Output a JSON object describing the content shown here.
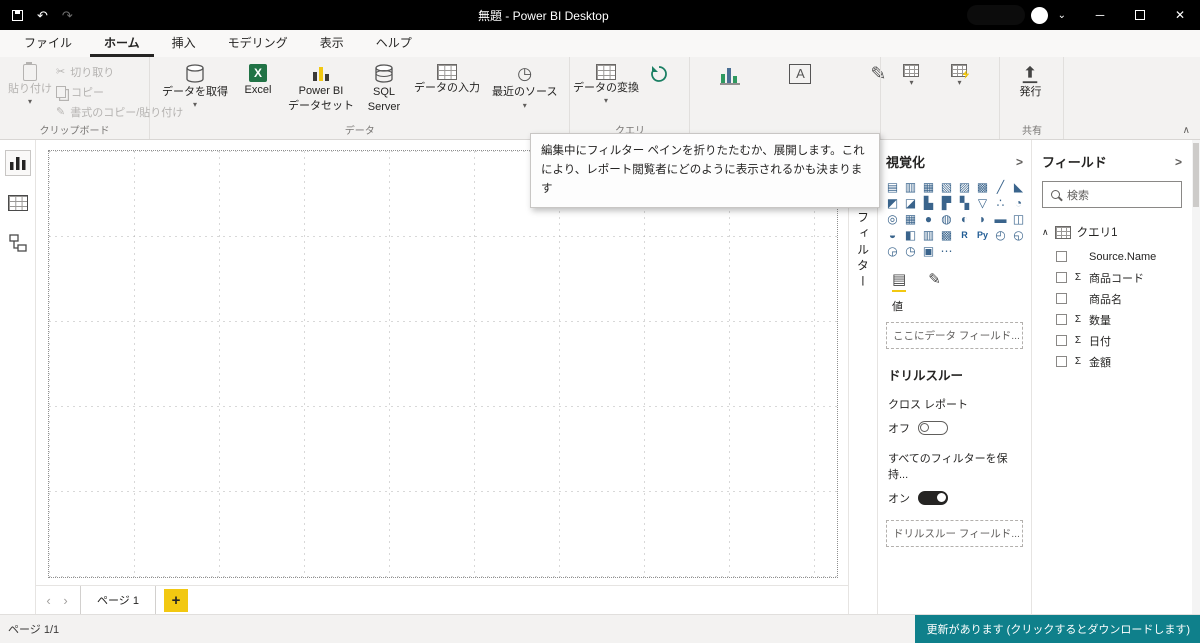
{
  "colors": {
    "accent_yellow": "#F2C811",
    "status_teal": "#0F808B",
    "titlebar_black": "#000000"
  },
  "titlebar": {
    "title": "無題 - Power BI Desktop"
  },
  "icons": {
    "undo": "↶",
    "redo": "↷",
    "chevron_down": "▾",
    "chevron_up": "∧",
    "collapse_left": "<",
    "collapse_right": ">",
    "minimize": "─",
    "close": "✕",
    "scissors": "✂",
    "pencil": "✎",
    "clock": "◷",
    "letter_a": "A",
    "prev": "‹",
    "next": "›",
    "add": "+",
    "account_chev": "⌄",
    "sigma": "Σ"
  },
  "menu": {
    "items": [
      "ファイル",
      "ホーム",
      "挿入",
      "モデリング",
      "表示",
      "ヘルプ"
    ],
    "active_index": 1
  },
  "ribbon": {
    "clipboard": {
      "group": "クリップボード",
      "paste": "貼り付け",
      "cut": "切り取り",
      "copy": "コピー",
      "format": "書式のコピー/貼り付け"
    },
    "data": {
      "group": "データ",
      "get_data": "データを取得",
      "excel": "Excel",
      "pbi1": "Power BI",
      "pbi2": "データセット",
      "sql1": "SQL",
      "sql2": "Server",
      "enter": "データの入力",
      "recent": "最近のソース"
    },
    "queries": {
      "group": "クエリ",
      "transform": "データの変換"
    },
    "share": {
      "group": "共有",
      "publish": "発行"
    },
    "tooltip": "編集中にフィルター ペインを折りたたむか、展開します。これにより、レポート閲覧者にどのように表示されるかも決まります"
  },
  "filters": {
    "title": "フィルター"
  },
  "visualizations": {
    "title": "視覚化",
    "values_label": "値",
    "field_placeholder": "ここにデータ フィールド...",
    "drillthrough": {
      "title": "ドリルスルー",
      "cross_report": "クロス レポート",
      "off": "オフ",
      "keep_filters": "すべてのフィルターを保持...",
      "on": "オン",
      "field_placeholder": "ドリルスルー フィールド..."
    },
    "icons": [
      {
        "name": "stacked-bar-chart",
        "glyph": "▤"
      },
      {
        "name": "stacked-column-chart",
        "glyph": "▥"
      },
      {
        "name": "clustered-bar-chart",
        "glyph": "▦"
      },
      {
        "name": "clustered-column-chart",
        "glyph": "▧"
      },
      {
        "name": "100-stacked-bar-chart",
        "glyph": "▨"
      },
      {
        "name": "100-stacked-column-chart",
        "glyph": "▩"
      },
      {
        "name": "line-chart",
        "glyph": "╱"
      },
      {
        "name": "area-chart",
        "glyph": "◣"
      },
      {
        "name": "stacked-area-chart",
        "glyph": "◩"
      },
      {
        "name": "line-and-stacked-column-chart",
        "glyph": "◪"
      },
      {
        "name": "line-and-clustered-column-chart",
        "glyph": "▙"
      },
      {
        "name": "ribbon-chart",
        "glyph": "▛"
      },
      {
        "name": "waterfall-chart",
        "glyph": "▚"
      },
      {
        "name": "funnel-chart",
        "glyph": "▽"
      },
      {
        "name": "scatter-chart",
        "glyph": "∴"
      },
      {
        "name": "pie-chart",
        "glyph": "◔"
      },
      {
        "name": "donut-chart",
        "glyph": "◎"
      },
      {
        "name": "treemap-chart",
        "glyph": "▦"
      },
      {
        "name": "map",
        "glyph": "●"
      },
      {
        "name": "filled-map",
        "glyph": "◍"
      },
      {
        "name": "shape-map",
        "glyph": "◐"
      },
      {
        "name": "gauge-chart",
        "glyph": "◗"
      },
      {
        "name": "card-visual",
        "glyph": "▬"
      },
      {
        "name": "multi-row-card",
        "glyph": "◫"
      },
      {
        "name": "kpi-visual",
        "glyph": "◒"
      },
      {
        "name": "slicer",
        "glyph": "◧"
      },
      {
        "name": "table-visual",
        "glyph": "▥"
      },
      {
        "name": "matrix-visual",
        "glyph": "▩"
      },
      {
        "name": "r-script-visual",
        "glyph": "R"
      },
      {
        "name": "python-visual",
        "glyph": "Py"
      },
      {
        "name": "key-influencers",
        "glyph": "◴"
      },
      {
        "name": "decomposition-tree",
        "glyph": "◵"
      },
      {
        "name": "qna-visual",
        "glyph": "◶"
      },
      {
        "name": "smart-narrative",
        "glyph": "◷"
      },
      {
        "name": "paginated-report",
        "glyph": "▣"
      },
      {
        "name": "more-visuals",
        "glyph": "⋯"
      }
    ]
  },
  "fields_pane": {
    "title": "フィールド",
    "search_placeholder": "検索",
    "table_name": "クエリ1",
    "fields": [
      {
        "name": "Source.Name",
        "sigma": false
      },
      {
        "name": "商品コード",
        "sigma": true
      },
      {
        "name": "商品名",
        "sigma": false
      },
      {
        "name": "数量",
        "sigma": true
      },
      {
        "name": "日付",
        "sigma": true
      },
      {
        "name": "金額",
        "sigma": true
      }
    ]
  },
  "pages": {
    "tab": "ページ 1"
  },
  "statusbar": {
    "left": "ページ 1/1",
    "update_notice": "更新があります (クリックするとダウンロードします)"
  }
}
